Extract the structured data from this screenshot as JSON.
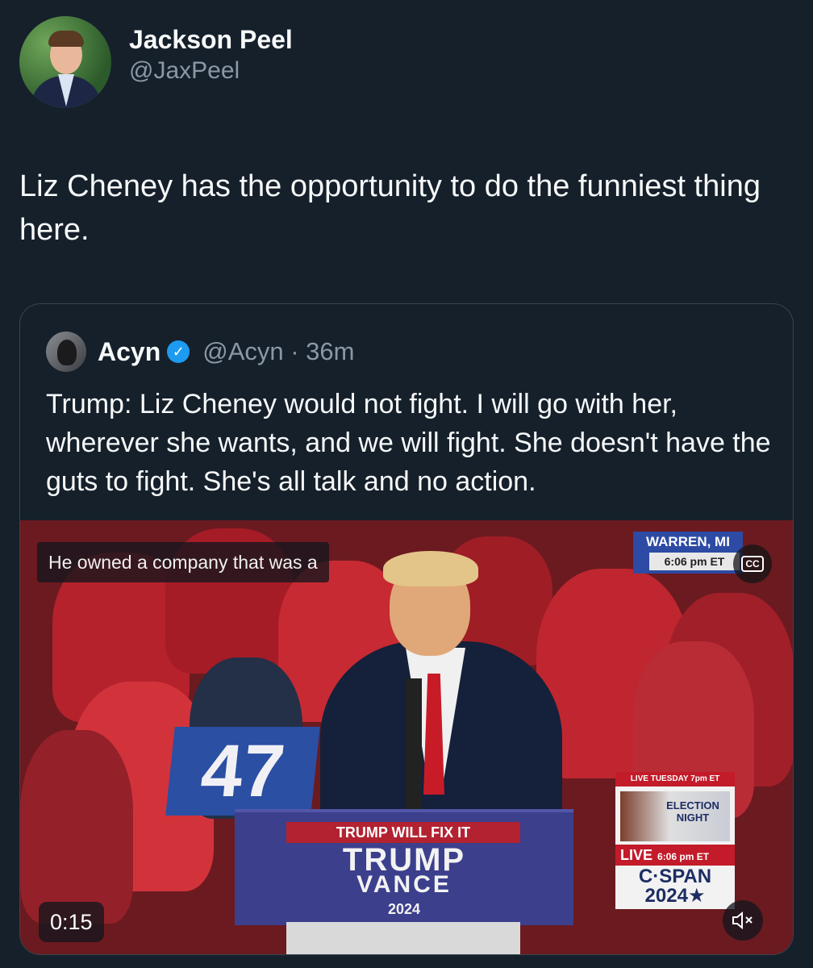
{
  "author": {
    "display_name": "Jackson Peel",
    "handle": "@JaxPeel",
    "avatar": "jackson-peel-avatar"
  },
  "tweet": {
    "text": "Liz Cheney has the opportunity to do the funniest thing here."
  },
  "quoted_tweet": {
    "display_name": "Acyn",
    "handle_time": "@Acyn · 36m",
    "verified_icon": "verified-badge-icon",
    "text": "Trump: Liz Cheney would not fight. I will go with her, wherever she wants, and we will fight. She doesn't have the guts to fight. She's all talk and no action."
  },
  "video": {
    "location": "WARREN, MI",
    "location_time": "6:06 pm ET",
    "cc_label": "CC",
    "caption": "He owned a company that was a",
    "duration": "0:15",
    "sign_number": "47",
    "podium_banner": "TRUMP WILL FIX IT",
    "podium_name": "TRUMP",
    "podium_vp": "VANCE",
    "podium_year": "2024",
    "promo_schedule": "LIVE TUESDAY 7pm ET",
    "promo_title": "ELECTION NIGHT",
    "promo_live": "LIVE",
    "promo_live_time": "6:06 pm ET",
    "promo_network": "C·SPAN 2024★",
    "mute_icon": "speaker-muted-icon",
    "accent_red": "#c31b2a",
    "accent_blue": "#2d4aa4"
  },
  "theme": {
    "background": "#15202b",
    "link_blue": "#1d9bf0",
    "secondary_text": "#8b98a5"
  }
}
